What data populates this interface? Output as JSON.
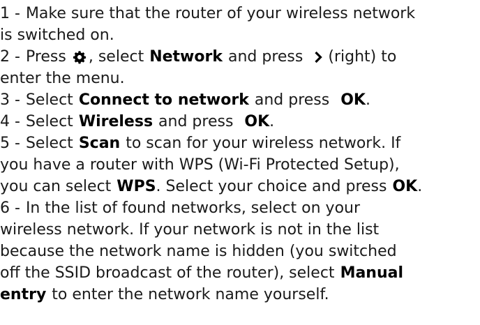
{
  "steps": [
    {
      "num": "1 -",
      "lines": [
        [
          "Make sure that the router of your wireless network"
        ],
        [
          "is switched on."
        ]
      ]
    },
    {
      "num": "2 -",
      "press": "Press",
      "icon_gear": "gear-icon",
      "select": ", select",
      "network": "Network",
      "and_press": "and press",
      "icon_chevron": "chevron-right-icon",
      "right": "(right) to",
      "enter": "enter the menu."
    },
    {
      "num": "3 -",
      "select": "Select",
      "option": "Connect to network",
      "and_press": "and press",
      "key": "OK",
      "end": "."
    },
    {
      "num": "4 -",
      "select": "Select",
      "option": "Wireless",
      "and_press": "and press",
      "key": "OK",
      "end": "."
    },
    {
      "num": "5 -",
      "select": "Select",
      "option": "Scan",
      "rest1": "to scan for your wireless network. If",
      "line2": "you have a router with WPS (Wi-Fi Protected Setup),",
      "line3_a": "you can select",
      "wps": "WPS",
      "line3_b": ". Select your choice and press",
      "key": "OK",
      "end": "."
    },
    {
      "num": "6 -",
      "line1": "In the list of found networks, select on your",
      "line2": "wireless network. If your network is not in the list",
      "line3": "because the network name is hidden (you switched",
      "line4_a": "off the SSID broadcast of the router), select",
      "manual_a": "Manual",
      "manual_b": "entry",
      "line5_b": "to enter the network name yourself."
    }
  ]
}
